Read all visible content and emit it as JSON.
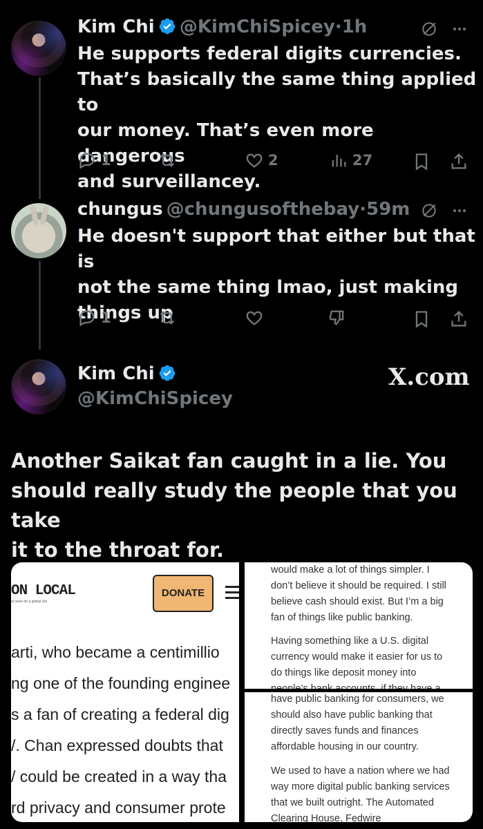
{
  "tweet1": {
    "name": "Kim Chi",
    "handle": "@KimChiSpicey",
    "time": "1h",
    "text_lines": [
      "He supports federal digits currencies.",
      "That’s basically the same thing applied to",
      "our money. That’s even more dangerous",
      "and surveillancey."
    ],
    "replies": "1",
    "likes": "2",
    "views": "27"
  },
  "tweet2": {
    "name": "chungus",
    "handle": "@chungusofthebay",
    "time": "59m",
    "text_lines": [
      "He doesn't support that either but that is",
      "not the same thing lmao, just making",
      "things up"
    ],
    "replies": "1"
  },
  "quote": {
    "name": "Kim Chi",
    "handle": "@KimChiSpicey",
    "site": "X.com",
    "text_lines": [
      "Another Saikat fan caught in a lie. You",
      "should really study the people that you take",
      "it to the throat for."
    ]
  },
  "article_left": {
    "logo": "ON LOCAL",
    "tagline": "al news for a global city",
    "donate": "DONATE",
    "lines": [
      "arti, who became a centimillio",
      "ng one of the founding enginee",
      "s a fan of creating a federal dig",
      "/. Chan expressed doubts that",
      "/ could be created in a way tha",
      "rd privacy and consumer prote"
    ]
  },
  "article_top_right": {
    "p1": "would make a lot of things simpler. I don’t believe it should be required. I still believe cash should exist. But I’m a big fan of things like public banking.",
    "p2": "Having something like a U.S. digital currency would make it easier for us to do things like deposit money into people’s bank accounts, if they have a"
  },
  "article_bottom_right": {
    "p1": "have public banking for consumers, we should also have public banking that directly saves funds and finances affordable housing in our country.",
    "p2": "We used to have a nation where we had way more digital public banking services that we built outright. The Automated Clearing House, Fedwire"
  },
  "colors": {
    "background": "#000000",
    "text": "#e7e9ea",
    "muted": "#71767b",
    "verified": "#1d9bf0",
    "donate": "#f0b673"
  }
}
